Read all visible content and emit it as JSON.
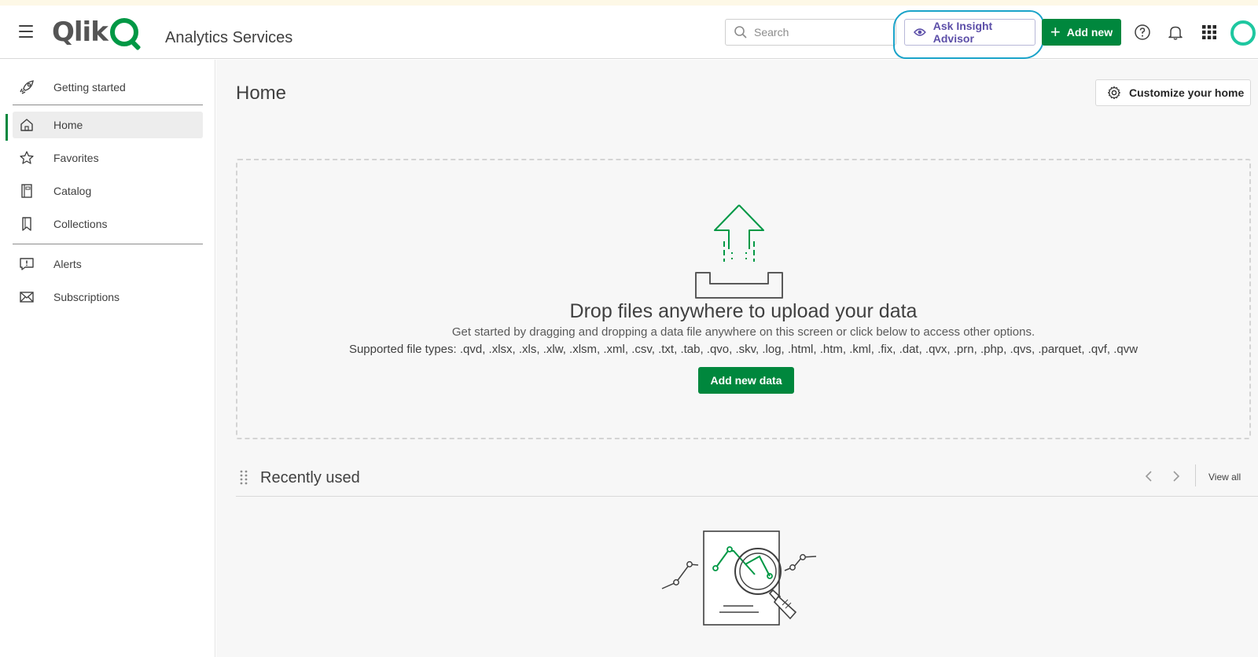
{
  "header": {
    "app_title": "Analytics Services",
    "logo_text": "Qlik",
    "search_placeholder": "Search",
    "insight_label": "Ask Insight Advisor",
    "add_new_label": "Add new",
    "icons": [
      "menu-icon",
      "search-icon",
      "insight-eye-icon",
      "plus-icon",
      "help-icon",
      "bell-icon",
      "apps-grid-icon",
      "avatar"
    ]
  },
  "sidebar": {
    "items": [
      {
        "label": "Getting started",
        "icon": "rocket-icon"
      },
      {
        "label": "Home",
        "icon": "home-icon",
        "active": true
      },
      {
        "label": "Favorites",
        "icon": "star-icon"
      },
      {
        "label": "Catalog",
        "icon": "catalog-icon"
      },
      {
        "label": "Collections",
        "icon": "bookmark-icon"
      },
      {
        "label": "Alerts",
        "icon": "alert-icon"
      },
      {
        "label": "Subscriptions",
        "icon": "envelope-icon"
      }
    ]
  },
  "main": {
    "page_title": "Home",
    "customize_label": "Customize your home",
    "dropzone": {
      "title": "Drop files anywhere to upload your data",
      "subtitle": "Get started by dragging and dropping a data file anywhere on this screen or click below to access other options.",
      "file_types": "Supported file types: .qvd, .xlsx, .xls, .xlw, .xlsm, .xml, .csv, .txt, .tab, .qvo, .skv, .log, .html, .htm, .kml, .fix, .dat, .qvx, .prn, .php, .qvs, .parquet, .qvf, .qvw",
      "button_label": "Add new data"
    },
    "recent": {
      "title": "Recently used",
      "view_all": "View all"
    }
  },
  "colors": {
    "brand_green": "#009845",
    "button_green": "#00873d",
    "insight_purple": "#5c4fa8",
    "annotation_cyan": "#1aa3c9",
    "avatar_teal": "#1ec7a0"
  }
}
